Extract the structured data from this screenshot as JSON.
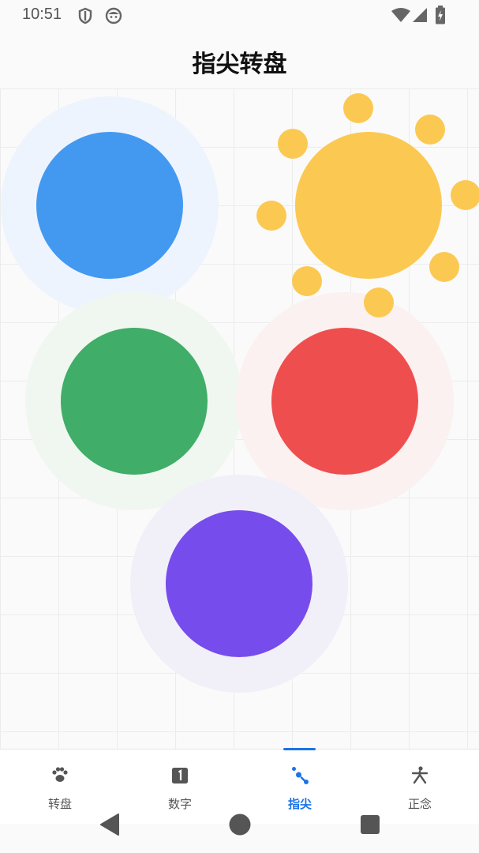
{
  "status_bar": {
    "time": "10:51",
    "left_icons": [
      "shield-icon",
      "face-icon"
    ],
    "right_icons": [
      "wifi-icon",
      "cellular-signal-icon",
      "battery-charging-icon"
    ]
  },
  "header": {
    "title": "指尖转盘"
  },
  "canvas": {
    "fingers": [
      {
        "name": "blue-finger",
        "color": "#4399f0",
        "halo_color": "#eef4fd"
      },
      {
        "name": "yellow-finger",
        "color": "#fbc952",
        "selected": true,
        "ray_count": 8
      },
      {
        "name": "green-finger",
        "color": "#40ad68",
        "halo_color": "#f0f7f0"
      },
      {
        "name": "red-finger",
        "color": "#ef4e4e",
        "halo_color": "#faf1f0"
      },
      {
        "name": "purple-finger",
        "color": "#774cec",
        "halo_color": "#f1f0f9"
      }
    ],
    "grid_color": "#ececec"
  },
  "bottom_nav": {
    "accent_color": "#1a73e8",
    "items": [
      {
        "label": "转盘",
        "icon": "paw-icon",
        "active": false
      },
      {
        "label": "数字",
        "icon": "number-one-icon",
        "active": false
      },
      {
        "label": "指尖",
        "icon": "fingertip-icon",
        "active": true
      },
      {
        "label": "正念",
        "icon": "meditation-icon",
        "active": false
      }
    ]
  },
  "system_nav": {
    "buttons": [
      "back-button",
      "home-button",
      "recents-button"
    ]
  }
}
